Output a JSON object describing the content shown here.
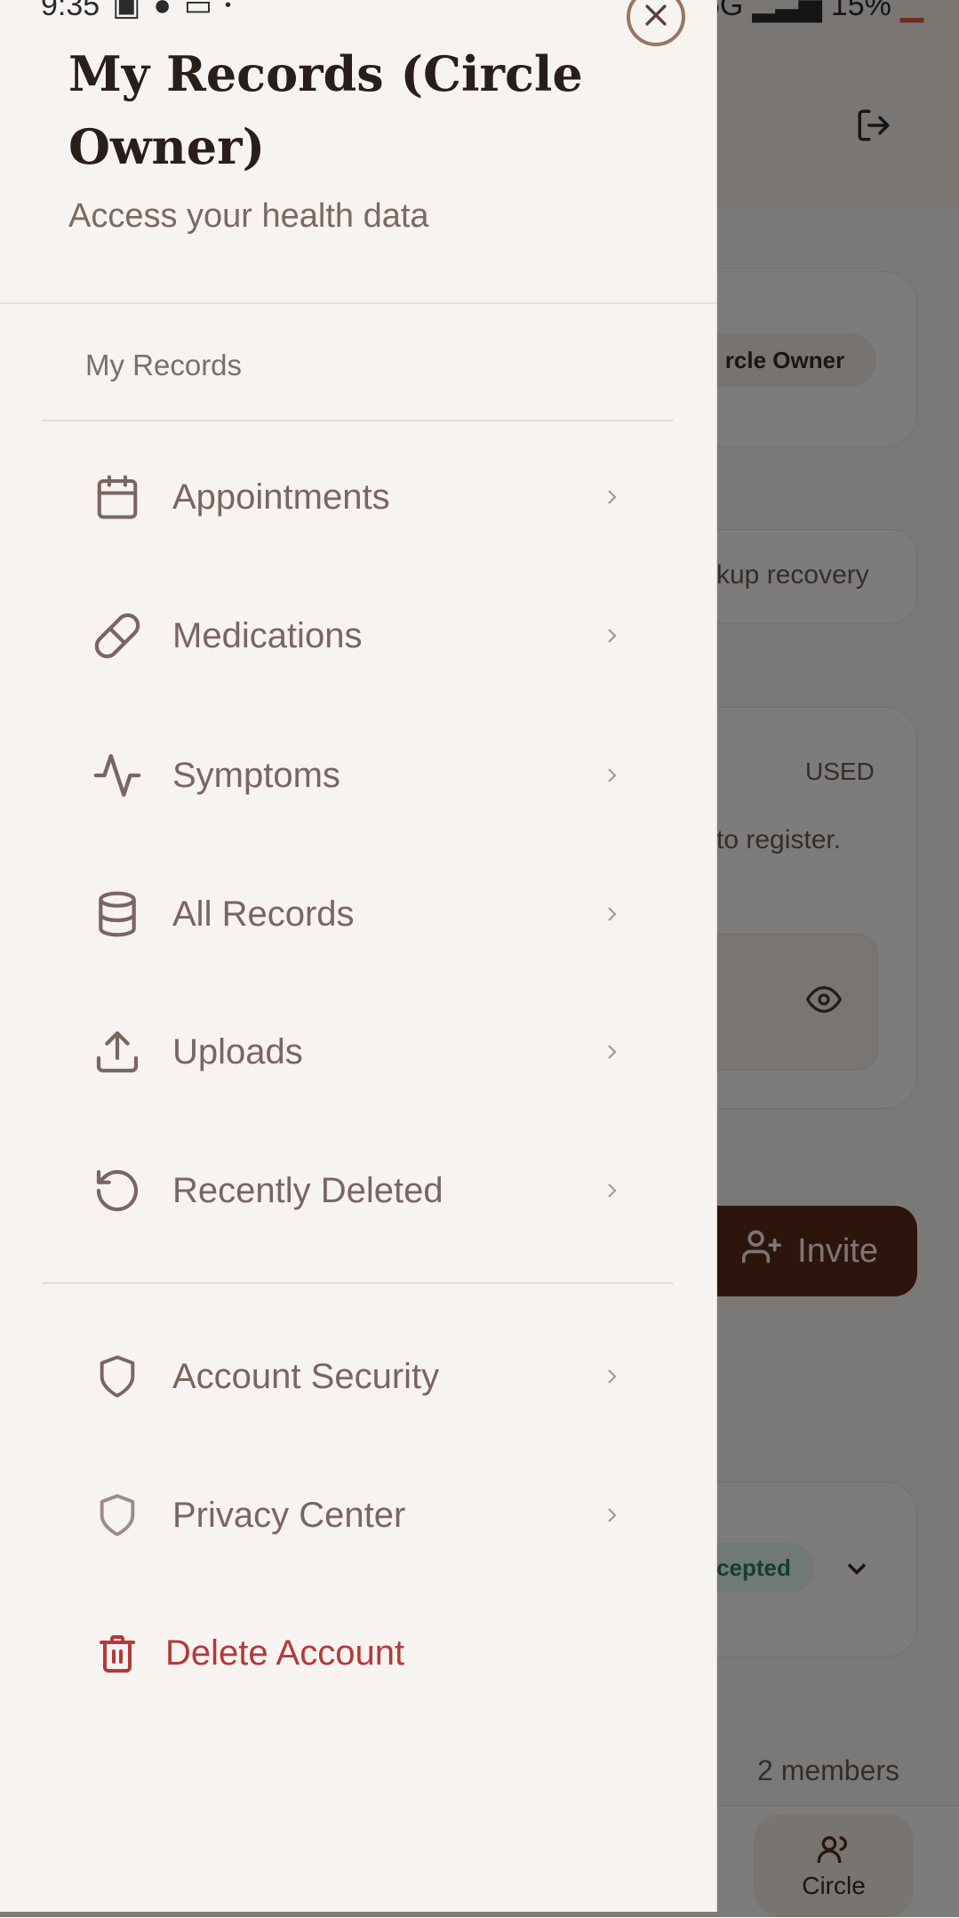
{
  "status_bar": {
    "time": "9:35",
    "network": "5G",
    "battery": "15%"
  },
  "drawer": {
    "title": "My Records (Circle Owner)",
    "subtitle": "Access your health data",
    "section_label": "My Records",
    "items": [
      {
        "label": "Appointments",
        "icon": "calendar-icon"
      },
      {
        "label": "Medications",
        "icon": "pill-icon"
      },
      {
        "label": "Symptoms",
        "icon": "activity-icon"
      },
      {
        "label": "All Records",
        "icon": "database-icon"
      },
      {
        "label": "Uploads",
        "icon": "upload-icon"
      },
      {
        "label": "Recently Deleted",
        "icon": "history-icon"
      }
    ],
    "account_items": [
      {
        "label": "Account Security",
        "icon": "shield-icon"
      },
      {
        "label": "Privacy Center",
        "icon": "shield-icon"
      }
    ],
    "delete_label": "Delete Account"
  },
  "background": {
    "role_badge": "rcle Owner",
    "backup_text": "kup recovery",
    "used_label": "USED",
    "register_text": "to register.",
    "invite_label": "Invite",
    "status_pill": "cepted",
    "members_text": "2 members",
    "nav_circle_label": "Circle"
  },
  "colors": {
    "accent": "#5a2a17",
    "danger": "#b23a3a",
    "text_muted": "#7a6560"
  }
}
